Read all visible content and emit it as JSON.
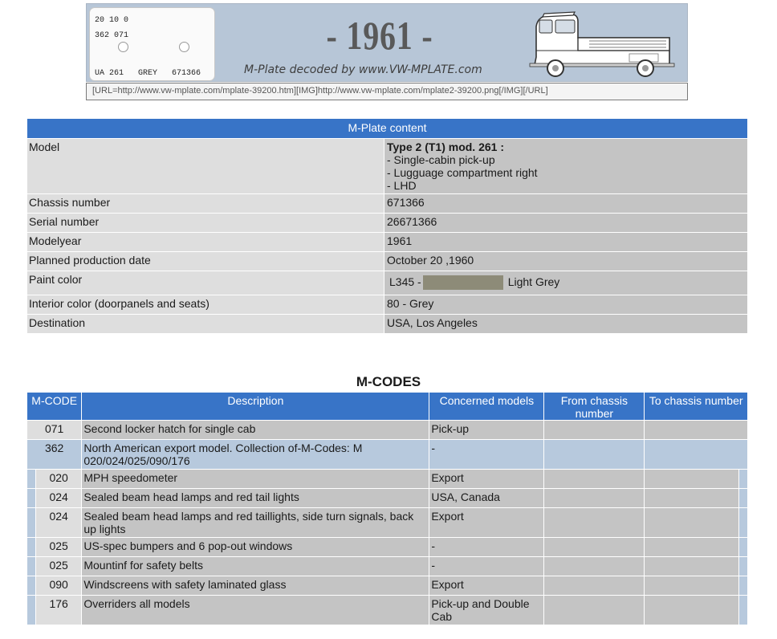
{
  "banner": {
    "plate_line1": "20 10 0",
    "plate_line2": "362 071",
    "plate_line3": "UA 261   GREY   671366",
    "year": "- 1961 -",
    "credit": "M-Plate decoded by www.VW-MPLATE.com",
    "vehicle_icon": "pickup-bus-icon",
    "url_text": "[URL=http://www.vw-mplate.com/mplate-39200.htm][IMG]http://www.vw-mplate.com/mplate2-39200.png[/IMG][/URL]"
  },
  "mplate": {
    "header": "M-Plate content",
    "rows": [
      {
        "key": "Model",
        "value_bold": "Type 2 (T1) mod. 261 :",
        "value_lines": [
          "- Single-cabin pick-up",
          "- Lugguage compartment right",
          "- LHD"
        ]
      },
      {
        "key": "Chassis number",
        "value": "671366"
      },
      {
        "key": "Serial number",
        "value": "26671366"
      },
      {
        "key": "Modelyear",
        "value": "1961"
      },
      {
        "key": "Planned production date",
        "value": "October 20 ,1960"
      },
      {
        "key": "Paint color",
        "paint_code": "L345 -",
        "paint_name": "Light Grey",
        "paint_swatch": "#8d8b78"
      },
      {
        "key": "Interior color (doorpanels and seats)",
        "value": "80 - Grey"
      },
      {
        "key": "Destination",
        "value": "USA, Los Angeles"
      }
    ]
  },
  "mcodes": {
    "title": "M-CODES",
    "headers": [
      "M-CODE",
      "Description",
      "Concerned models",
      "From chassis number",
      "To chassis number"
    ],
    "rows": [
      {
        "code": "071",
        "desc": "Second locker hatch for single cab",
        "models": "Pick-up",
        "from": "",
        "to": ""
      },
      {
        "code": "362",
        "desc": "North American export model. Collection of-M-Codes: M 020/024/025/090/176",
        "models": "-",
        "from": "",
        "to": ""
      }
    ],
    "subrows": [
      {
        "code": "020",
        "desc": "MPH speedometer",
        "models": "Export"
      },
      {
        "code": "024",
        "desc": "Sealed beam head lamps and red tail lights",
        "models": "USA, Canada"
      },
      {
        "code": "024",
        "desc": "Sealed beam head lamps and red taillights, side turn signals, back up lights",
        "models": "Export"
      },
      {
        "code": "025",
        "desc": "US-spec bumpers and 6 pop-out windows",
        "models": "-"
      },
      {
        "code": "025",
        "desc": "Mountinf for safety belts",
        "models": "-"
      },
      {
        "code": "090",
        "desc": "Windscreens with safety laminated glass",
        "models": "Export"
      },
      {
        "code": "176",
        "desc": "Overriders all models",
        "models": "Pick-up and Double Cab"
      }
    ]
  }
}
